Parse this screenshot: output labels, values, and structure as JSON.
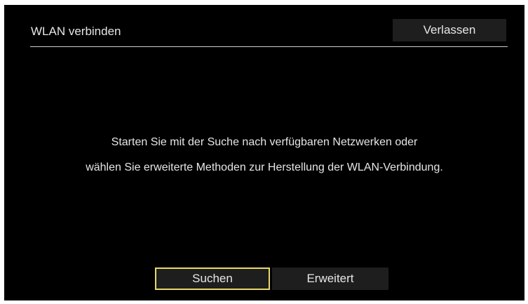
{
  "header": {
    "title": "WLAN verbinden",
    "exit_label": "Verlassen"
  },
  "message": {
    "line1": "Starten Sie mit der Suche nach verfügbaren Netzwerken oder",
    "line2": "wählen Sie erweiterte Methoden zur Herstellung der WLAN-Verbindung."
  },
  "buttons": {
    "search_label": "Suchen",
    "advanced_label": "Erweitert",
    "focused": "Suchen"
  },
  "colors": {
    "background": "#000000",
    "text": "#e6e6e6",
    "button_background": "#1e1e1e",
    "focus_border": "#e8d96b"
  }
}
